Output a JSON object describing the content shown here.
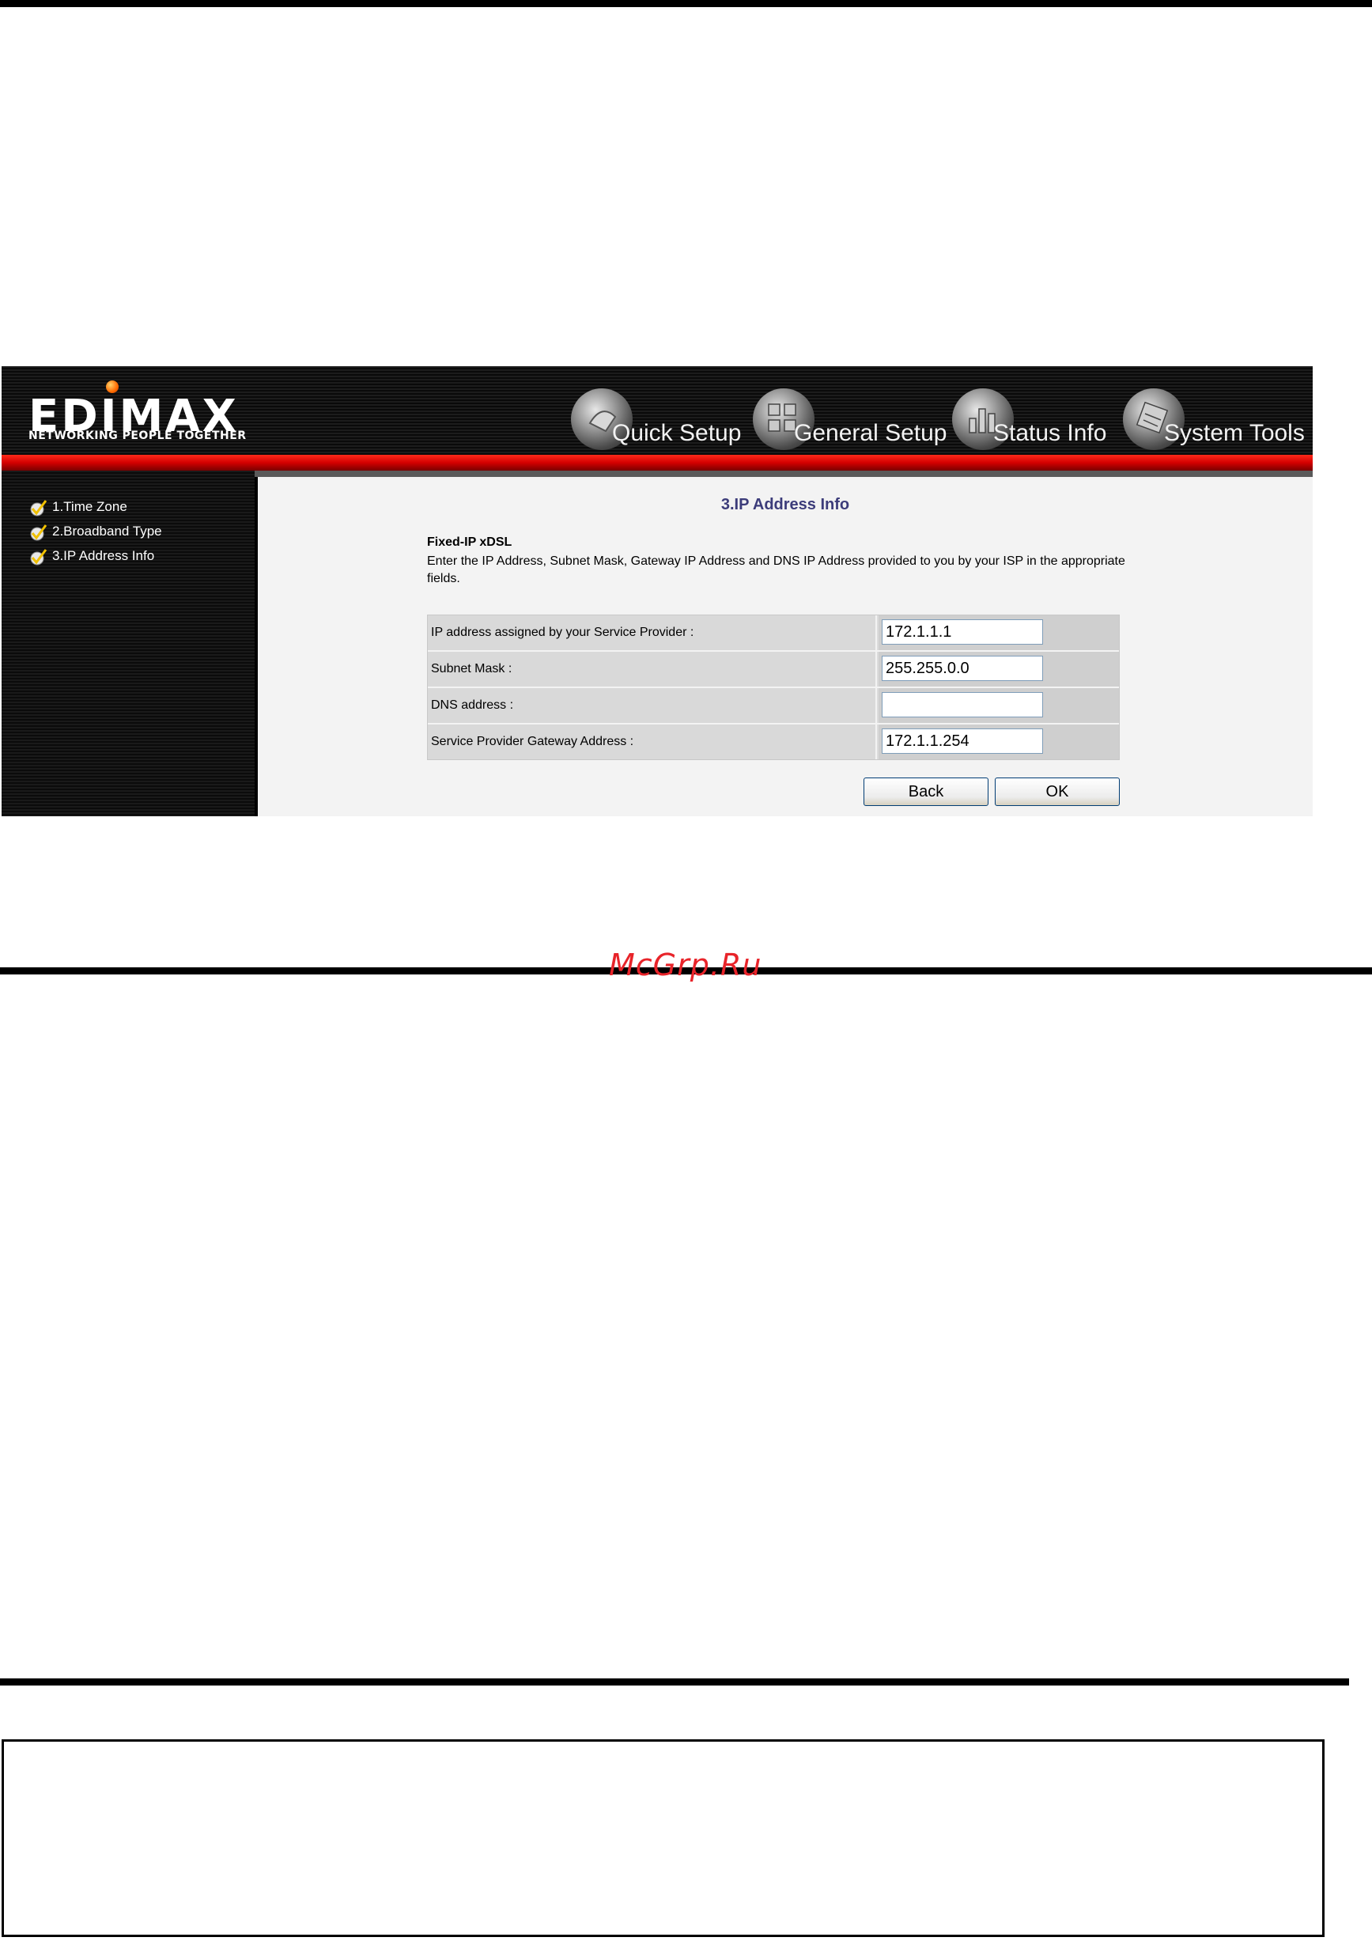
{
  "brand": {
    "logo": "EDIMAX",
    "tagline": "NETWORKING PEOPLE TOGETHER"
  },
  "nav": [
    {
      "label": "Quick Setup",
      "icon": "quick-setup-icon"
    },
    {
      "label": "General Setup",
      "icon": "general-setup-icon"
    },
    {
      "label": "Status Info",
      "icon": "status-info-icon"
    },
    {
      "label": "System Tools",
      "icon": "system-tools-icon"
    }
  ],
  "sidebar": {
    "items": [
      {
        "label": "1.Time Zone",
        "icon": "checkmark-icon"
      },
      {
        "label": "2.Broadband Type",
        "icon": "checkmark-icon"
      },
      {
        "label": "3.IP Address Info",
        "icon": "checkmark-icon"
      }
    ]
  },
  "main": {
    "title": "3.IP Address Info",
    "section_heading": "Fixed-IP xDSL",
    "description": "Enter the IP Address, Subnet Mask, Gateway IP Address and DNS IP Address provided to you by your ISP in the appropriate fields.",
    "fields": [
      {
        "label": "IP address assigned by your Service Provider :",
        "value": "172.1.1.1"
      },
      {
        "label": "Subnet Mask :",
        "value": "255.255.0.0"
      },
      {
        "label": "DNS address :",
        "value": ""
      },
      {
        "label": "Service Provider Gateway Address :",
        "value": "172.1.1.254"
      }
    ],
    "buttons": {
      "back": "Back",
      "ok": "OK"
    }
  },
  "watermark": "McGrp.Ru",
  "colors": {
    "accent_red": "#d40000",
    "title_blue": "#3c3c7a",
    "watermark_red": "#e8242a"
  }
}
